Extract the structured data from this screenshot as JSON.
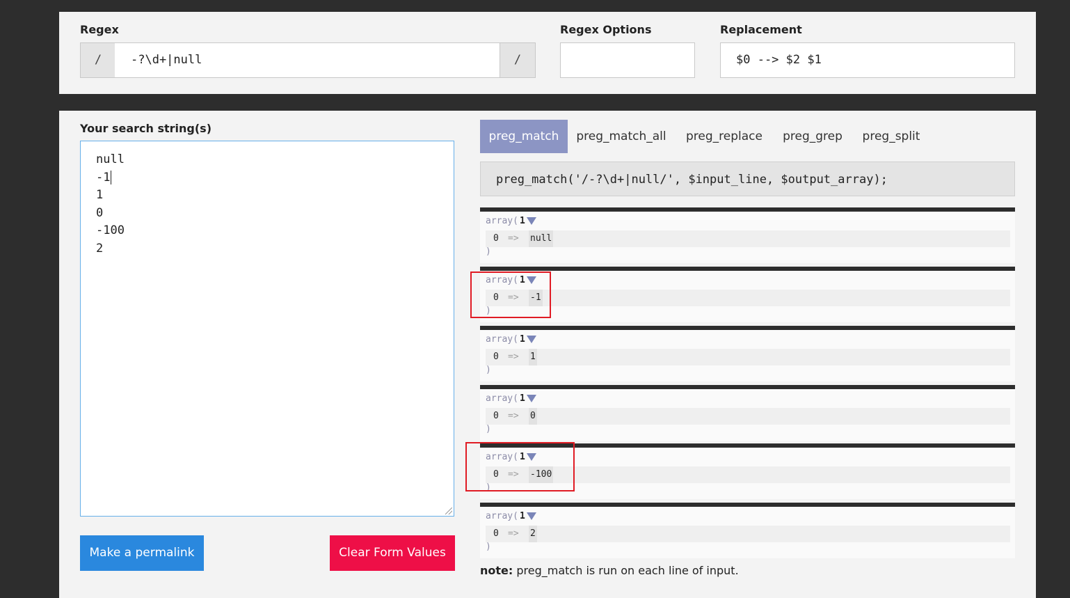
{
  "top": {
    "regex_label": "Regex",
    "regex_delim_left": "/",
    "regex_value": "-?\\d+|null",
    "regex_delim_right": "/",
    "options_label": "Regex Options",
    "options_value": "",
    "replacement_label": "Replacement",
    "replacement_value": "$0 --> $2 $1"
  },
  "search": {
    "label": "Your search string(s)",
    "lines": [
      "null",
      "-1",
      "1",
      "0",
      "-100",
      "2"
    ]
  },
  "buttons": {
    "permalink": "Make a permalink",
    "clear": "Clear Form Values"
  },
  "tabs": [
    {
      "label": "preg_match",
      "active": true
    },
    {
      "label": "preg_match_all",
      "active": false
    },
    {
      "label": "preg_replace",
      "active": false
    },
    {
      "label": "preg_grep",
      "active": false
    },
    {
      "label": "preg_split",
      "active": false
    }
  ],
  "code": "preg_match('/-?\\d+|null/', $input_line, $output_array);",
  "results": [
    {
      "head": "array(",
      "count": "1",
      "key": "0",
      "arrow": "=>",
      "value": "null",
      "close": ")"
    },
    {
      "head": "array(",
      "count": "1",
      "key": "0",
      "arrow": "=>",
      "value": "-1",
      "close": ")"
    },
    {
      "head": "array(",
      "count": "1",
      "key": "0",
      "arrow": "=>",
      "value": "1",
      "close": ")"
    },
    {
      "head": "array(",
      "count": "1",
      "key": "0",
      "arrow": "=>",
      "value": "0",
      "close": ")"
    },
    {
      "head": "array(",
      "count": "1",
      "key": "0",
      "arrow": "=>",
      "value": "-100",
      "close": ")"
    },
    {
      "head": "array(",
      "count": "1",
      "key": "0",
      "arrow": "=>",
      "value": "2",
      "close": ")"
    }
  ],
  "note": {
    "bold": "note:",
    "text": " preg_match is run on each line of input."
  },
  "colors": {
    "active_tab": "#8c95c4",
    "permalink_button": "#2a88de",
    "clear_button": "#ee0f47",
    "highlight_box": "#e01b24"
  }
}
